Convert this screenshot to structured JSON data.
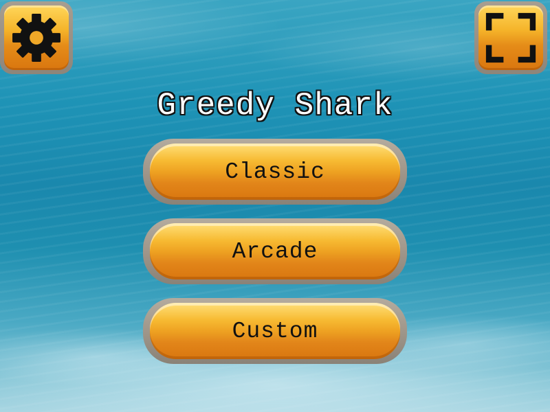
{
  "game": {
    "title": "Greedy Shark"
  },
  "menu": {
    "classic_label": "Classic",
    "arcade_label": "Arcade",
    "custom_label": "Custom"
  },
  "icons": {
    "settings": "gear-icon",
    "fullscreen": "fullscreen-icon"
  },
  "colors": {
    "button_orange": "#eea222",
    "button_frame": "#a79e91",
    "water": "#1e93b6"
  }
}
